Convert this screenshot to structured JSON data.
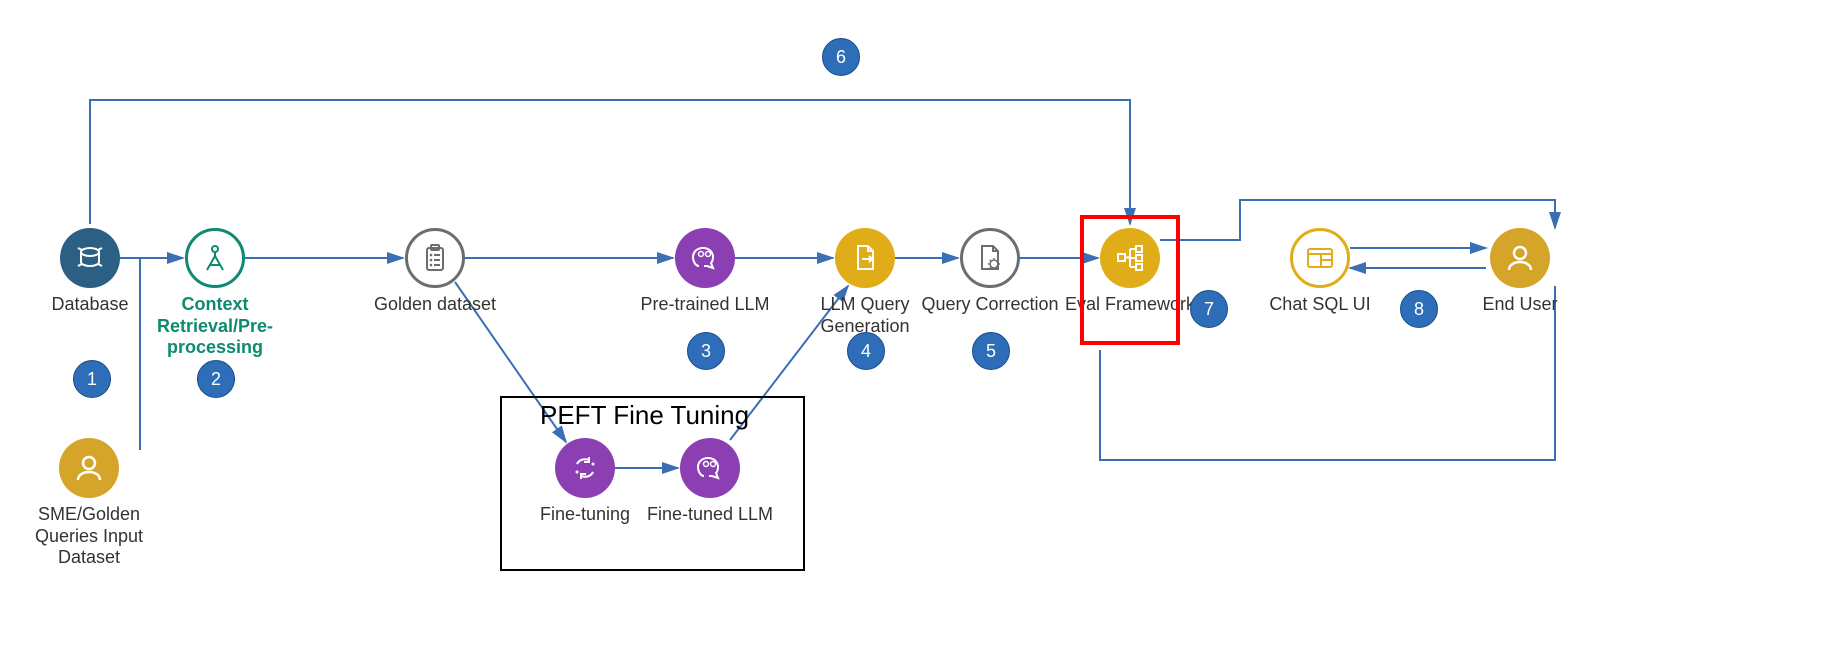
{
  "nodes": {
    "database": {
      "label": "Database"
    },
    "context": {
      "label": "Context Retrieval/Pre-processing"
    },
    "golden": {
      "label": "Golden dataset"
    },
    "pretrained": {
      "label": "Pre-trained LLM"
    },
    "querygen": {
      "label": "LLM Query Generation"
    },
    "querycorr": {
      "label": "Query Correction"
    },
    "eval": {
      "label": "Eval Framework"
    },
    "chatsql": {
      "label": "Chat SQL UI"
    },
    "enduser": {
      "label": "End User"
    },
    "sme": {
      "label": "SME/Golden Queries Input Dataset"
    },
    "finetuning": {
      "label": "Fine-tuning"
    },
    "finetunedllm": {
      "label": "Fine-tuned LLM"
    }
  },
  "peft_title": "PEFT Fine Tuning",
  "badges": {
    "b1": "1",
    "b2": "2",
    "b3": "3",
    "b4": "4",
    "b5": "5",
    "b6": "6",
    "b7": "7",
    "b8": "8"
  },
  "colors": {
    "badge_fill": "#2e6db7",
    "arrow": "#3b6fb5",
    "database_fill": "#2c5f84",
    "context_stroke": "#0d8a6f",
    "outline_gray": "#6d6d6d",
    "purple": "#8c3fb2",
    "gold": "#e0ac17",
    "highlight": "#ff0000"
  }
}
